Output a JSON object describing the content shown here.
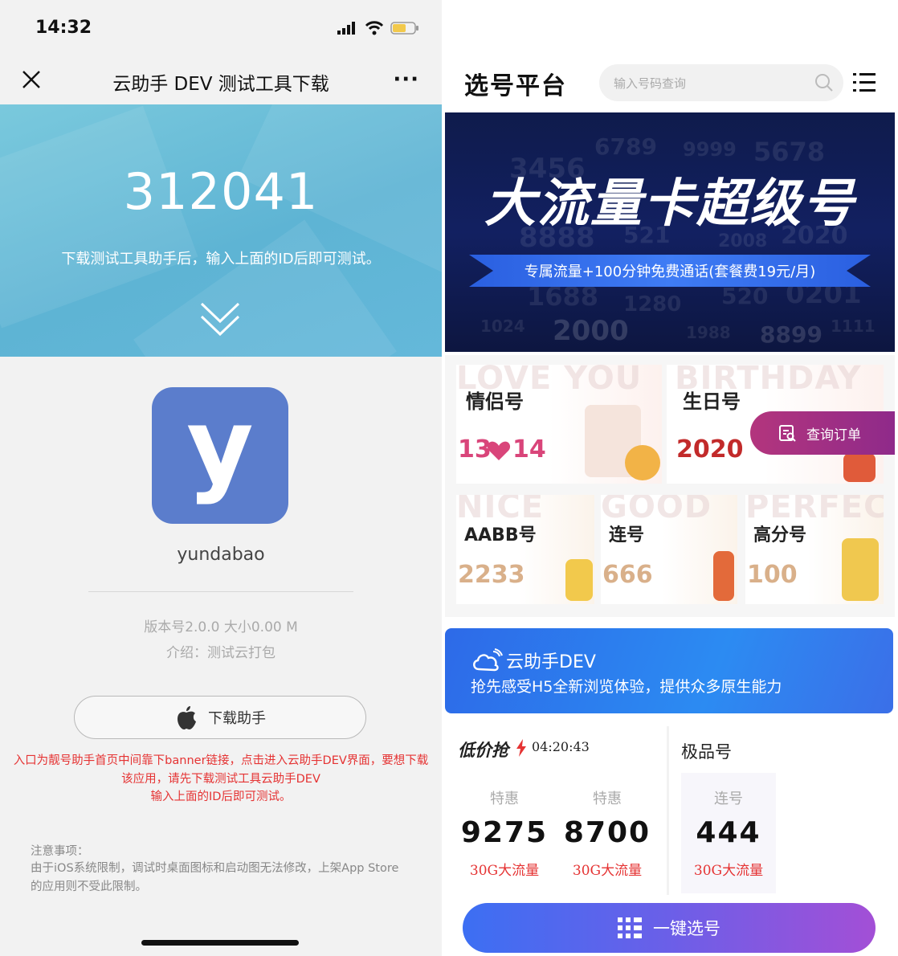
{
  "left": {
    "status": {
      "time": "14:32"
    },
    "nav": {
      "title": "云助手 DEV 测试工具下载",
      "more": "···"
    },
    "hero": {
      "id": "312041",
      "hint": "下载测试工具助手后，输入上面的ID后即可测试。"
    },
    "app": {
      "icon_letter": "y",
      "name": "yundabao",
      "version": "版本号2.0.0 大小0.00 M",
      "intro": "介绍：测试云打包"
    },
    "download_button": {
      "label": "下载助手",
      "icon": "apple-icon"
    },
    "red_note": {
      "line1": "入口为靓号助手首页中间靠下banner链接，点击进入云助手DEV界面，要想下载",
      "line2": "该应用，请先下载测试工具云助手DEV",
      "line3": "输入上面的ID后即可测试。"
    },
    "notice": {
      "title": "注意事项：",
      "body": "由于iOS系统限制，调试时桌面图标和启动图无法修改，上架App Store的应用则不受此限制。"
    }
  },
  "right": {
    "header": {
      "title": "选号平台",
      "search_placeholder": "输入号码查询"
    },
    "banner": {
      "title": "大流量卡超级号",
      "ribbon": "专属流量+100分钟免费通话(套餐费19元/月)",
      "bg_numbers": [
        "6789",
        "9999",
        "5678",
        "3456",
        "8888",
        "521",
        "2008",
        "2020",
        "1688",
        "1280",
        "520",
        "0201",
        "1024",
        "2000",
        "1988",
        "8899",
        "1111"
      ]
    },
    "categories": [
      {
        "title": "情侣号",
        "ghost": "LOVE YOU",
        "value_a": "13",
        "value_b": "14",
        "color": "#d9457a"
      },
      {
        "title": "生日号",
        "ghost": "BIRTHDAY",
        "value": "2020",
        "color": "#c22a2a"
      },
      {
        "title": "AABB号",
        "ghost": "NICE",
        "value": "2233",
        "color": "#d9b08a"
      },
      {
        "title": "连号",
        "ghost": "GOOD",
        "value": "666",
        "color": "#d9b08a"
      },
      {
        "title": "高分号",
        "ghost": "PERFECT",
        "value": "100",
        "color": "#d9b08a"
      }
    ],
    "order_button": {
      "label": "查询订单"
    },
    "promo": {
      "brand": "云助手DEV",
      "subtitle": "抢先感受H5全新浏览体验，提供众多原生能力"
    },
    "low_price": {
      "title": "低价抢",
      "timer": "04:20:43",
      "items": [
        {
          "tag": "特惠",
          "number": "9275",
          "note": "30G大流量"
        },
        {
          "tag": "特惠",
          "number": "8700",
          "note": "30G大流量"
        }
      ]
    },
    "premium": {
      "title": "极品号",
      "items": [
        {
          "tag": "连号",
          "number": "444",
          "note": "30G大流量"
        }
      ]
    },
    "cta": {
      "label": "一键选号"
    }
  },
  "colors": {
    "hero_blue": "#5eb4d4",
    "app_icon": "#5b7dcc",
    "accent_red": "#e53333",
    "banner_navy": "#122061",
    "cta_start": "#3c6ff3",
    "cta_end": "#a34fd6"
  }
}
